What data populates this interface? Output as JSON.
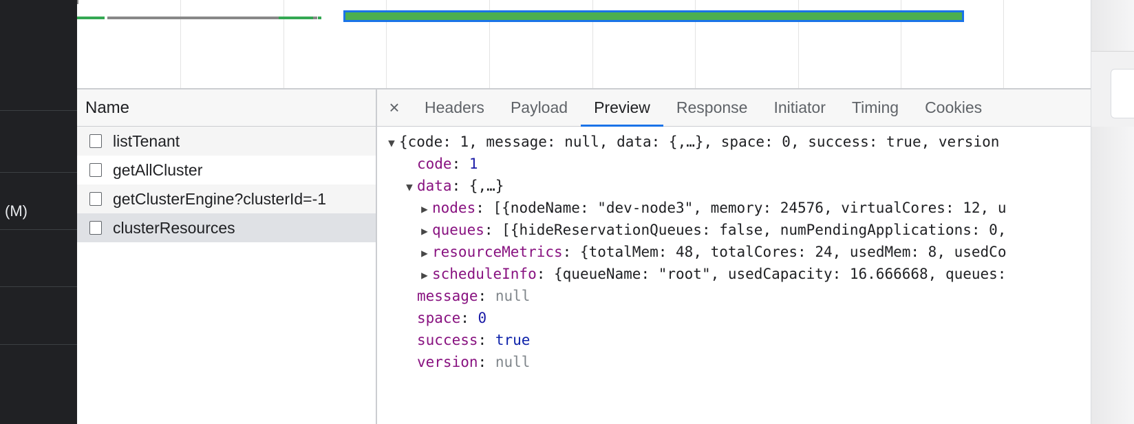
{
  "left_app": {
    "label": "(M)"
  },
  "network": {
    "name_header": "Name",
    "requests": [
      {
        "name": "listTenant"
      },
      {
        "name": "getAllCluster"
      },
      {
        "name": "getClusterEngine?clusterId=-1"
      },
      {
        "name": "clusterResources"
      }
    ],
    "selected_request": "clusterResources"
  },
  "detail": {
    "close_glyph": "×",
    "tabs": [
      "Headers",
      "Payload",
      "Preview",
      "Response",
      "Initiator",
      "Timing",
      "Cookies"
    ],
    "active_tab": "Preview"
  },
  "preview": {
    "root_summary": "{code: 1, message: null, data: {,…}, space: 0, success: true, version",
    "code_key": "code",
    "code_value": "1",
    "data_key": "data",
    "data_summary": "{,…}",
    "nodes_key": "nodes",
    "nodes_summary": "[{nodeName: \"dev-node3\", memory: 24576, virtualCores: 12, u",
    "queues_key": "queues",
    "queues_summary": "[{hideReservationQueues: false, numPendingApplications: 0,",
    "resourceMetrics_key": "resourceMetrics",
    "resourceMetrics_summary": "{totalMem: 48, totalCores: 24, usedMem: 8, usedCo",
    "scheduleInfo_key": "scheduleInfo",
    "scheduleInfo_summary": "{queueName: \"root\", usedCapacity: 16.666668, queues:",
    "message_key": "message",
    "message_value": "null",
    "space_key": "space",
    "space_value": "0",
    "success_key": "success",
    "success_value": "true",
    "version_key": "version",
    "version_value": "null"
  },
  "colors": {
    "accent": "#1a73e8",
    "timing_bar": "#34a853",
    "json_key": "#881280",
    "json_number": "#1a1aa6"
  }
}
